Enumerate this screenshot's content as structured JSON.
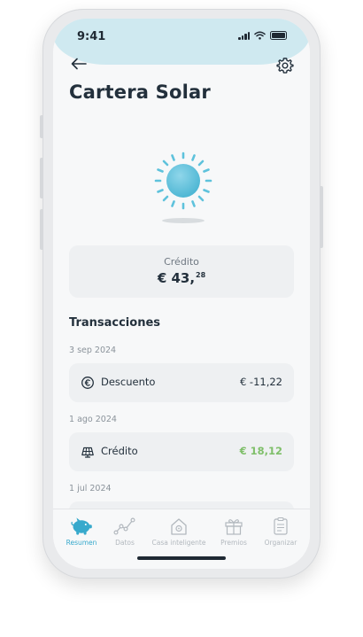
{
  "status_bar": {
    "time": "9:41"
  },
  "header": {
    "title": "Cartera Solar",
    "back_icon": "arrow-left-icon",
    "settings_icon": "gear-icon"
  },
  "credit": {
    "label": "Crédito",
    "amount_main": "€ 43,",
    "amount_cents": "28"
  },
  "transactions": {
    "section_title": "Transacciones",
    "groups": [
      {
        "date": "3 sep 2024",
        "label": "Descuento",
        "amount": "€ -11,22",
        "icon": "euro-circle-icon"
      },
      {
        "date": "1 ago 2024",
        "label": "Crédito",
        "amount": "€ 18,12",
        "icon": "solar-panel-icon"
      },
      {
        "date": "1 jul 2024"
      }
    ]
  },
  "nav": {
    "items": [
      {
        "label": "Resumen",
        "icon": "piggy-bank-icon",
        "active": true
      },
      {
        "label": "Datos",
        "icon": "line-chart-icon"
      },
      {
        "label": "Casa inteligente",
        "icon": "smart-home-icon"
      },
      {
        "label": "Premios",
        "icon": "gift-icon"
      },
      {
        "label": "Organizar",
        "icon": "clipboard-icon"
      }
    ]
  },
  "colors": {
    "accent": "#37a9cc",
    "positive": "#7fbf6a",
    "status_bar_bg": "#cfe9f0",
    "sun": "#5ec2dc"
  }
}
